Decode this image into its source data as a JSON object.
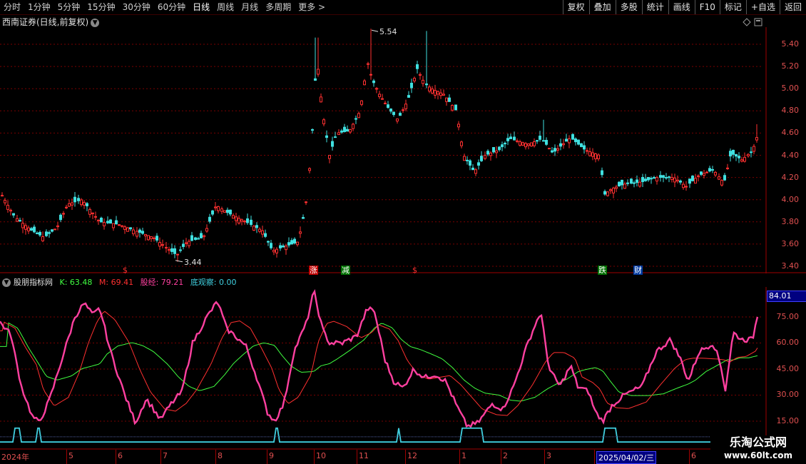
{
  "toolbar": {
    "periods": [
      "分时",
      "1分钟",
      "5分钟",
      "15分钟",
      "30分钟",
      "60分钟",
      "日线",
      "周线",
      "月线",
      "多周期",
      "更多 >"
    ],
    "active_period": "日线",
    "right_buttons": [
      "复权",
      "叠加",
      "多股",
      "统计",
      "画线",
      "F10",
      "标记",
      "+自选",
      "返回"
    ]
  },
  "main_chart": {
    "title": "西南证券(日线,前复权)",
    "price_ticks": [
      "5.40",
      "5.20",
      "5.00",
      "4.80",
      "4.60",
      "4.40",
      "4.20",
      "4.00",
      "3.80",
      "3.60",
      "3.40"
    ],
    "high_label": "5.54",
    "low_label": "3.44",
    "markers": [
      {
        "text": "$",
        "color": "#ff3030",
        "bg": "transparent"
      },
      {
        "text": "涨",
        "color": "#ffffff",
        "bg": "#c00000"
      },
      {
        "text": "减",
        "color": "#ffffff",
        "bg": "#007000"
      },
      {
        "text": "$",
        "color": "#ff3030",
        "bg": "transparent"
      },
      {
        "text": "跌",
        "color": "#ffffff",
        "bg": "#007000"
      },
      {
        "text": "财",
        "color": "#ffffff",
        "bg": "#003aa0"
      }
    ]
  },
  "indicator": {
    "name": "股朋指标网",
    "k_label": "K: 63.48",
    "m_label": "M: 69.41",
    "gj_label": "股经: 79.21",
    "dgc_label": "底观察: 0.00",
    "current_value": "84.01",
    "ticks": [
      "75.00",
      "60.00",
      "45.00",
      "30.00",
      "15.00"
    ]
  },
  "x_axis": {
    "labels": [
      "2024年",
      "5",
      "6",
      "7",
      "8",
      "9",
      "10",
      "11",
      "12",
      "1",
      "2",
      "3",
      "2025/04/02/三",
      "6"
    ]
  },
  "watermark": {
    "line1": "乐淘公式网",
    "line2": "www.60lt.com"
  },
  "colors": {
    "up": "#ff3030",
    "down": "#40e0e0",
    "k": "#40ff40",
    "m": "#ff3030",
    "gj": "#ff40a0",
    "dgc": "#40d0e0"
  }
}
